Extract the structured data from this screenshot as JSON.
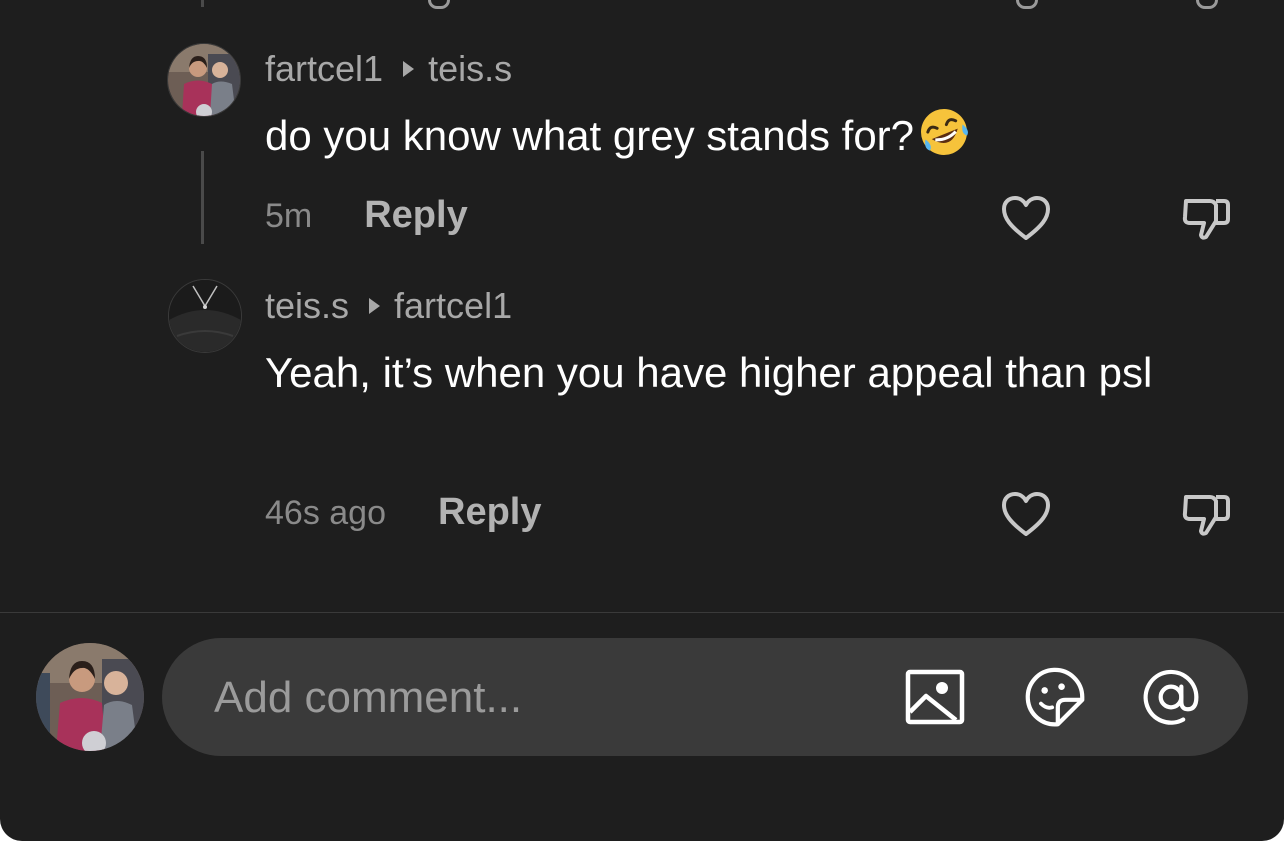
{
  "comments": [
    {
      "author": "fartcel1",
      "reply_to": "teis.s",
      "text": "do you know what grey stands for?",
      "emoji": "rolling-on-floor-laughing",
      "time": "5m",
      "reply_label": "Reply",
      "avatar": "user-photo"
    },
    {
      "author": "teis.s",
      "reply_to": "fartcel1",
      "text": "Yeah, it’s when you have higher appeal than psl",
      "time": "46s ago",
      "reply_label": "Reply",
      "avatar": "dark-photo"
    }
  ],
  "composer": {
    "placeholder": "Add comment...",
    "icons": [
      "image-icon",
      "sticker-icon",
      "mention-icon"
    ]
  },
  "colors": {
    "background": "#1e1e1e",
    "input_background": "#3a3a3a",
    "text_primary": "#ffffff",
    "text_secondary": "#a8a8a8"
  }
}
